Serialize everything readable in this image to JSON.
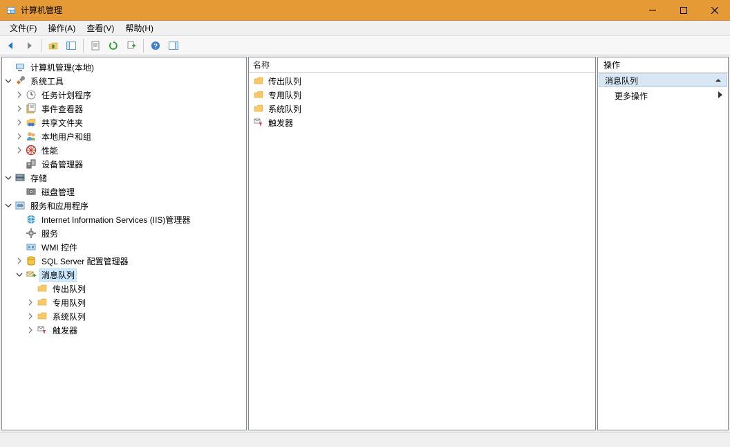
{
  "window": {
    "title": "计算机管理"
  },
  "menu": {
    "file": "文件(F)",
    "action": "操作(A)",
    "view": "查看(V)",
    "help": "帮助(H)"
  },
  "tree": {
    "root": "计算机管理(本地)",
    "system_tools": "系统工具",
    "task_scheduler": "任务计划程序",
    "event_viewer": "事件查看器",
    "shared_folders": "共享文件夹",
    "local_users": "本地用户和组",
    "performance": "性能",
    "device_manager": "设备管理器",
    "storage": "存储",
    "disk_mgmt": "磁盘管理",
    "services_apps": "服务和应用程序",
    "iis": "Internet Information Services (IIS)管理器",
    "services": "服务",
    "wmi": "WMI 控件",
    "sql": "SQL Server 配置管理器",
    "msmq": "消息队列",
    "outgoing": "传出队列",
    "private": "专用队列",
    "system_q": "系统队列",
    "triggers": "触发器"
  },
  "list": {
    "header_name": "名称",
    "items": {
      "0": "传出队列",
      "1": "专用队列",
      "2": "系统队列",
      "3": "触发器"
    }
  },
  "actions": {
    "header": "操作",
    "section": "消息队列",
    "more": "更多操作"
  }
}
